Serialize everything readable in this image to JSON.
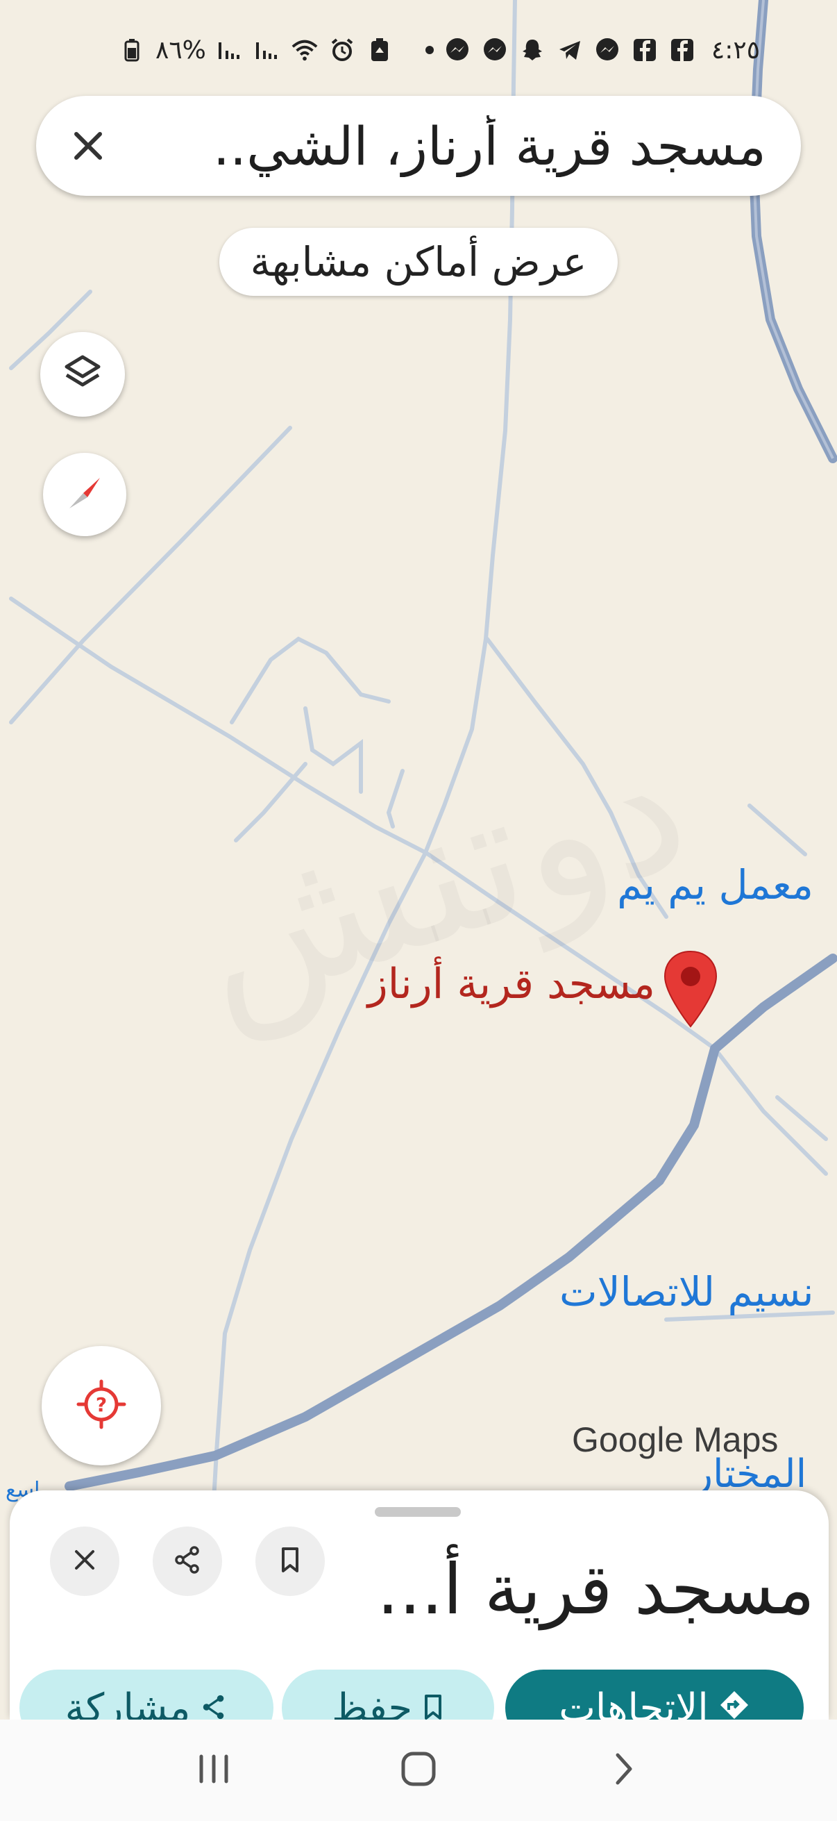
{
  "status_bar": {
    "time": "٤:٢٥",
    "battery_text": "٨٦%",
    "notification_icons": [
      "facebook-icon",
      "facebook-icon",
      "messenger-icon",
      "telegram-icon",
      "snapchat-icon",
      "messenger-icon",
      "messenger-icon"
    ],
    "system_icons": [
      "battery-saver-icon",
      "alarm-icon",
      "wifi-icon",
      "signal-icon",
      "signal-icon",
      "battery-icon"
    ]
  },
  "search": {
    "query": "مسجد قرية أرناز، الشي..",
    "close_icon": "close-icon"
  },
  "similar_places_chip": "عرض أماكن مشابهة",
  "map": {
    "labels": {
      "maamal": "معمل يم يم",
      "masjid": "مسجد قرية أرناز",
      "naseem": "نسيم للاتصالات",
      "mukhtar": "المختار",
      "small_place": "ماسع"
    },
    "watermark": "دوتنش",
    "google_logo": "Google Maps",
    "pin_color": "#e53935",
    "road_major_color": "#8a9fc0",
    "road_minor_color": "#c4d0de"
  },
  "controls": {
    "layers_icon": "layers-icon",
    "compass_icon": "compass-icon",
    "locate_icon": "location-unknown-icon"
  },
  "place_sheet": {
    "title": "مسجد قرية أ...",
    "action_icons": [
      "close-icon",
      "share-icon",
      "bookmark-icon"
    ],
    "buttons": {
      "directions": "الاتجاهات",
      "save": "حفظ",
      "share": "مشاركة"
    },
    "accent_color": "#0f7b83",
    "pill_bg": "#c6eef0"
  },
  "nav_bar": {
    "icons": [
      "recents-icon",
      "home-icon",
      "back-icon"
    ]
  }
}
